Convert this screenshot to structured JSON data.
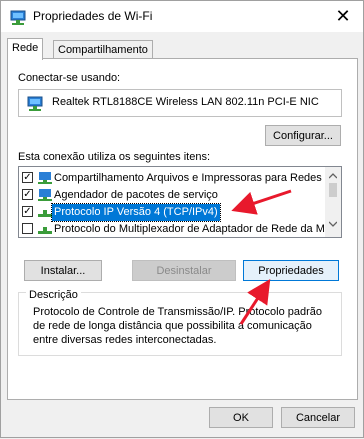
{
  "window": {
    "title": "Propriedades de Wi-Fi",
    "close_glyph": "✕"
  },
  "tabs": [
    {
      "label": "Rede",
      "active": true
    },
    {
      "label": "Compartilhamento",
      "active": false
    }
  ],
  "connect_using": {
    "label": "Conectar-se usando:",
    "adapter_name": "Realtek RTL8188CE Wireless LAN 802.11n PCI-E NIC",
    "configure_button": "Configurar..."
  },
  "items_section": {
    "label": "Esta conexão utiliza os seguintes itens:",
    "items": [
      {
        "label": "Compartilhamento Arquivos e Impressoras para Redes",
        "checked": true,
        "icon": "share-icon"
      },
      {
        "label": "Agendador de pacotes de serviço",
        "checked": true,
        "icon": "network-service-icon"
      },
      {
        "label": "Protocolo IP Versão 4 (TCP/IPv4)",
        "checked": true,
        "icon": "protocol-icon",
        "selected": true
      },
      {
        "label": "Protocolo do Multiplexador de Adaptador de Rede da M",
        "checked": false,
        "icon": "protocol-icon"
      }
    ]
  },
  "buttons": {
    "install": "Instalar...",
    "uninstall": "Desinstalar",
    "properties": "Propriedades"
  },
  "description": {
    "legend": "Descrição",
    "text_line1": "Protocolo de Controle de Transmissão/IP. Protocolo padrão",
    "text_line2": "de rede de longa distância que possibilita a comunicação",
    "text_line3": "entre diversas redes interconectadas."
  },
  "footer": {
    "ok": "OK",
    "cancel": "Cancelar"
  },
  "colors": {
    "accent": "#0078d7",
    "annotation_arrow": "#e8192c"
  },
  "check_glyph": "✓"
}
